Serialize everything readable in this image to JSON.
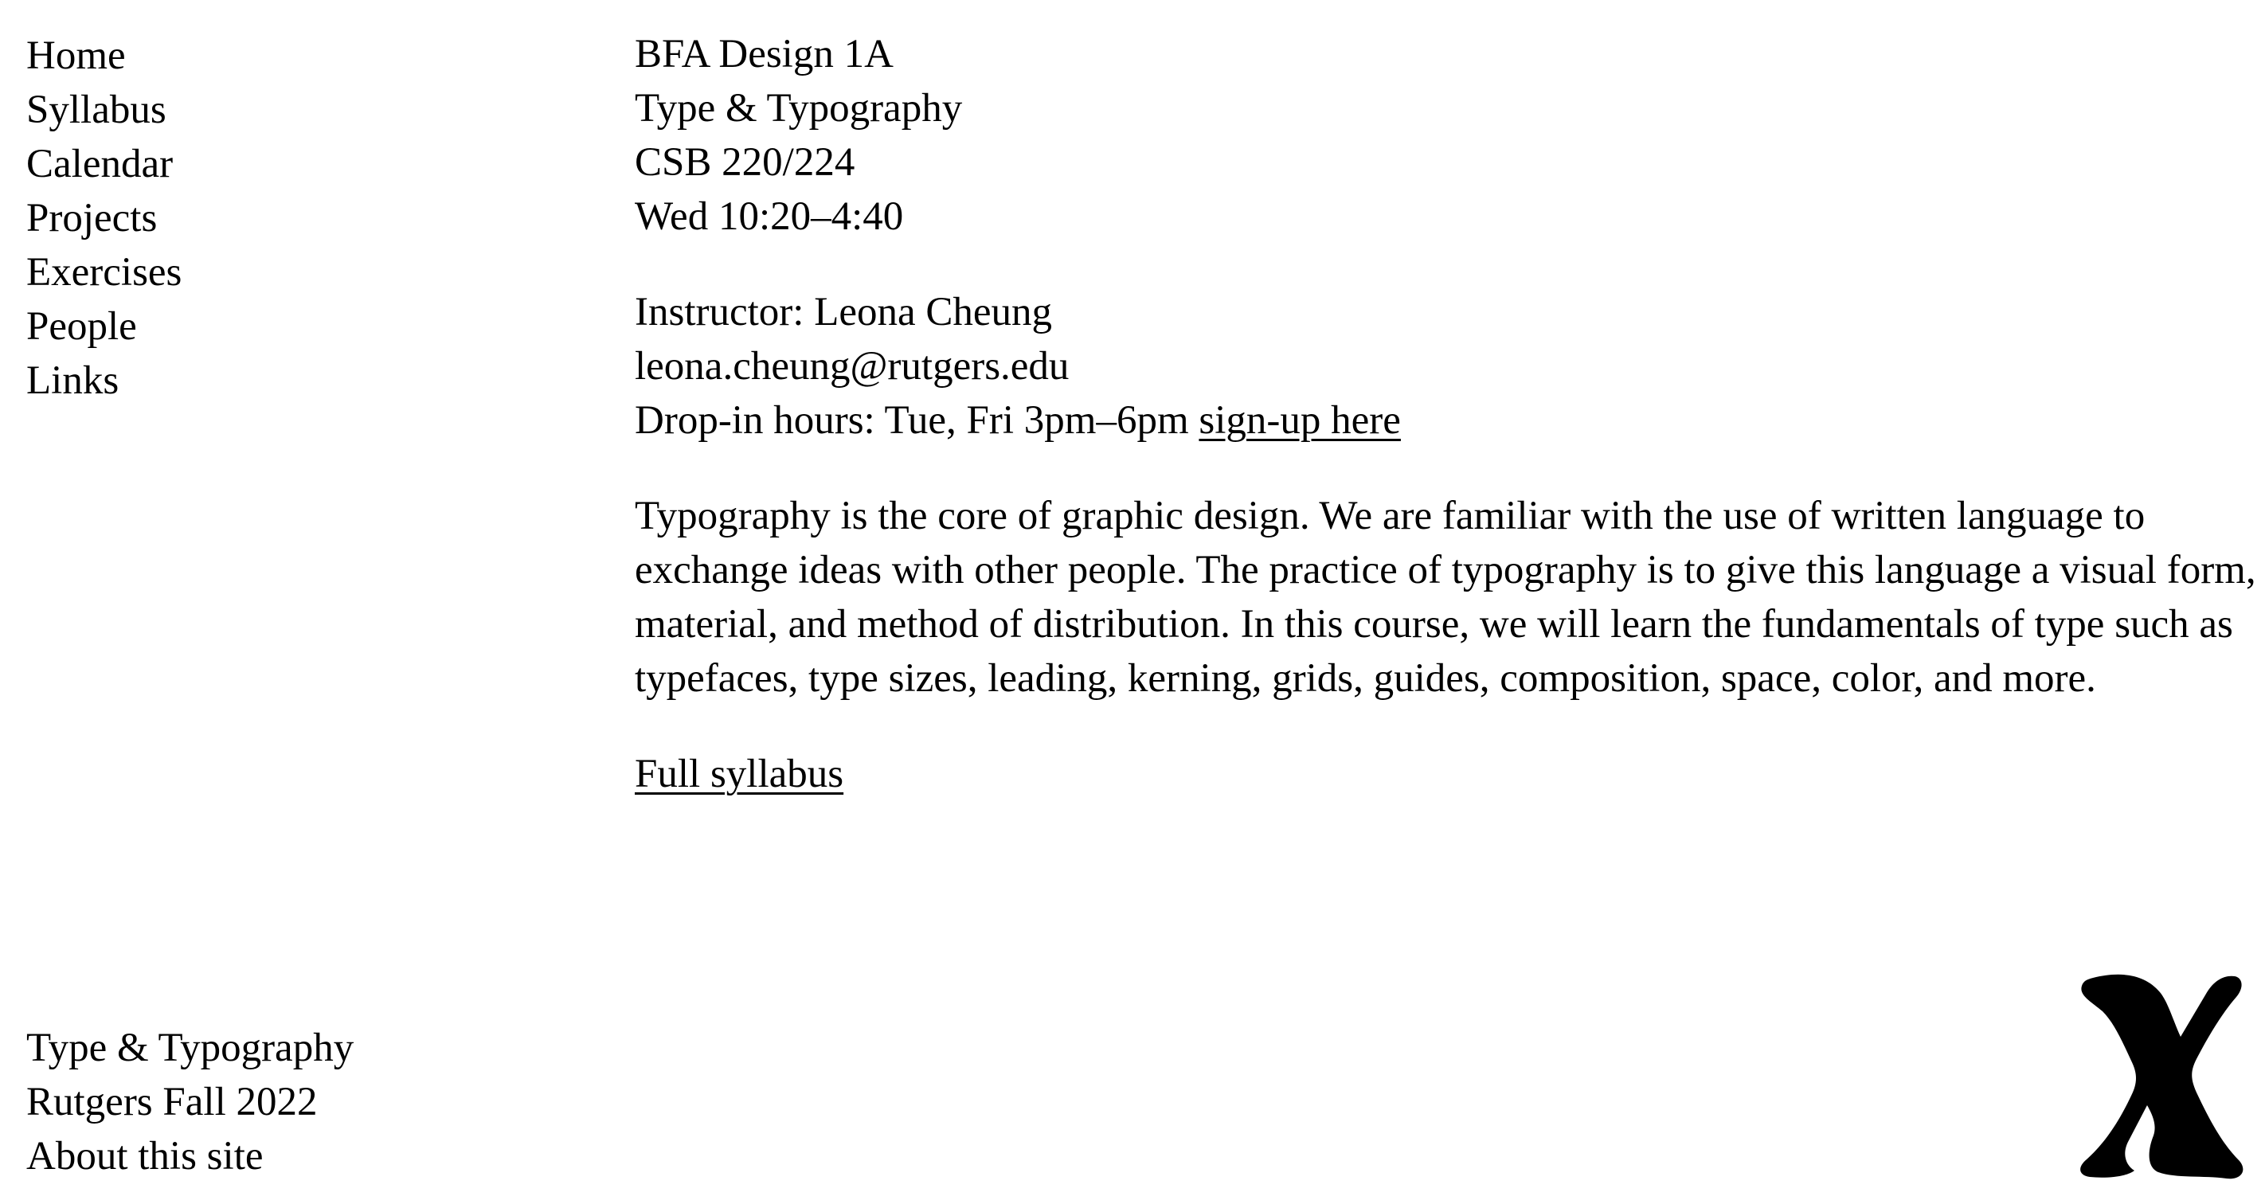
{
  "nav": {
    "items": [
      "Home",
      "Syllabus",
      "Calendar",
      "Projects",
      "Exercises",
      "People",
      "Links"
    ]
  },
  "course": {
    "title": "BFA Design 1A",
    "subtitle": "Type & Typography",
    "room": "CSB 220/224",
    "time": "Wed 10:20–4:40"
  },
  "instructor": {
    "name_line": "Instructor: Leona Cheung",
    "email": "leona.cheung@rutgers.edu",
    "hours_prefix": "Drop-in hours: Tue, Fri 3pm–6pm",
    "signup_link": "sign-up here"
  },
  "description": "Typography is the core of graphic design. We are familiar with the use of written language to exchange ideas with other people. The practice of typography is to give this language a visual form, material, and method of distribution. In this course, we will learn the fundamentals of type such as typefaces, type sizes, leading, kerning, grids, guides, composition, space, color, and more.",
  "full_syllabus_link": "Full syllabus",
  "footer": {
    "line1": "Type & Typography",
    "line2": "Rutgers Fall 2022",
    "about_link": "About this site"
  },
  "logo": {
    "icon": "x-logo-icon",
    "color": "#000000"
  }
}
